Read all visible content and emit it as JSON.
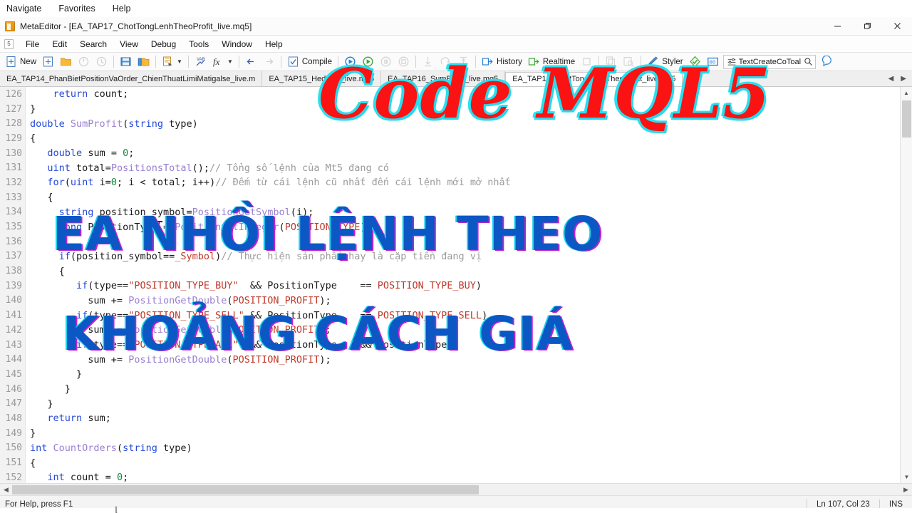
{
  "host_menu": {
    "items": [
      "Navigate",
      "Favorites",
      "Help"
    ]
  },
  "titlebar": {
    "app_icon": "metaeditor-icon",
    "title": "MetaEditor - [EA_TAP17_ChotTongLenhTheoProfit_live.mq5]",
    "minimize": "minimize-icon",
    "maximize": "restore-icon",
    "close": "close-icon"
  },
  "menubar": {
    "badge": "5",
    "items": [
      "File",
      "Edit",
      "Search",
      "View",
      "Debug",
      "Tools",
      "Window",
      "Help"
    ]
  },
  "toolbar": {
    "new_label": "New",
    "compile_label": "Compile",
    "history_label": "History",
    "realtime_label": "Realtime",
    "styler_label": "Styler",
    "search_value": "TextCreateCoToal",
    "icons": [
      "new-file-icon",
      "add-icon",
      "open-folder-icon",
      "undo-icon",
      "redo-icon",
      "save-icon",
      "save-all-icon",
      "print-icon",
      "navigator-icon",
      "function-icon",
      "back-arrow-icon",
      "forward-arrow-icon",
      "compile-icon",
      "debug-play-icon",
      "run-icon",
      "pause-icon",
      "stop-icon",
      "step-into-icon",
      "step-over-icon",
      "step-out-icon",
      "history-icon",
      "realtime-icon",
      "stop-debug-icon",
      "copy-icon",
      "find-icon",
      "styler-icon",
      "check-icon",
      "counter-icon",
      "settings-icon",
      "search-icon",
      "help-icon"
    ]
  },
  "tabs": {
    "items": [
      {
        "label": "EA_TAP14_PhanBietPositionVaOrder_ChienThuatLimiMatigalse_live.m",
        "active": false
      },
      {
        "label": "EA_TAP15_Hedging_live.mq5",
        "active": false
      },
      {
        "label": "EA_TAP16_SumProfit_live.mq5",
        "active": false
      },
      {
        "label": "EA_TAP17_ChotTongLenhTheoProfit_live.mq5",
        "active": true
      }
    ],
    "nav_prev": "◀",
    "nav_next": "▶"
  },
  "code": {
    "lines": [
      {
        "n": "126",
        "text": "    return count;"
      },
      {
        "n": "127",
        "text": "}"
      },
      {
        "n": "128",
        "text": "double SumProfit(string type)"
      },
      {
        "n": "129",
        "text": "{"
      },
      {
        "n": "130",
        "text": "   double sum = 0;"
      },
      {
        "n": "131",
        "text": "   uint total=PositionsTotal();// Tổng số lệnh của Mt5 đang có"
      },
      {
        "n": "132",
        "text": "   for(uint i=0; i < total; i++)// Đếm từ cái lệnh cũ nhất đến cái lệnh mới mở nhất"
      },
      {
        "n": "133",
        "text": "   {"
      },
      {
        "n": "134",
        "text": "     string position_symbol=PositionGetSymbol(i);"
      },
      {
        "n": "135",
        "text": "     long PositionType = PositionGetInteger(POSITION_TYPE);"
      },
      {
        "n": "136",
        "text": ""
      },
      {
        "n": "137",
        "text": "     if(position_symbol==_Symbol)// Thực hiện sản phẩm hay là cặp tiền đang vị"
      },
      {
        "n": "138",
        "text": "     {"
      },
      {
        "n": "139",
        "text": "        if(type==\"POSITION_TYPE_BUY\"  && PositionType    == POSITION_TYPE_BUY)"
      },
      {
        "n": "140",
        "text": "          sum += PositionGetDouble(POSITION_PROFIT);"
      },
      {
        "n": "141",
        "text": "        if(type==\"POSITION_TYPE_SELL\" && PositionType    == POSITION_TYPE_SELL)"
      },
      {
        "n": "142",
        "text": "          sum += PositionGetDouble(POSITION_PROFIT);"
      },
      {
        "n": "143",
        "text": "        if(type==\"POSITION_TYPE_ALL\"  && PositionType    && PositionType"
      },
      {
        "n": "144",
        "text": "          sum += PositionGetDouble(POSITION_PROFIT);"
      },
      {
        "n": "145",
        "text": "        }"
      },
      {
        "n": "146",
        "text": "      }"
      },
      {
        "n": "147",
        "text": "   }"
      },
      {
        "n": "148",
        "text": "   return sum;"
      },
      {
        "n": "149",
        "text": "}"
      },
      {
        "n": "150",
        "text": "int CountOrders(string type)"
      },
      {
        "n": "151",
        "text": "{"
      },
      {
        "n": "152",
        "text": "   int count = 0;"
      }
    ]
  },
  "statusbar": {
    "help_text": "For Help, press F1",
    "position": "Ln 107, Col 23",
    "insert_mode": "INS"
  },
  "overlays": {
    "red_title": "Code MQL5",
    "blue_line1": "EA NHỒI LỆNH THEO",
    "blue_line2": "KHOẢNG CÁCH GIÁ",
    "red_color": "#fb1212",
    "red_outline": "#27e0ef",
    "blue_color": "#0b57c4",
    "blue_outline_left": "#16d3f0",
    "blue_outline_right": "#c51fd0"
  },
  "colors": {
    "keyword": "#2449d6",
    "comment": "#9b9b9b",
    "string": "#c0392b",
    "builtin": "#9a7fd0",
    "number": "#0e8a3b",
    "gutter_bg": "#f2f2f2",
    "toolbar_bg": "#fbfbfb"
  }
}
